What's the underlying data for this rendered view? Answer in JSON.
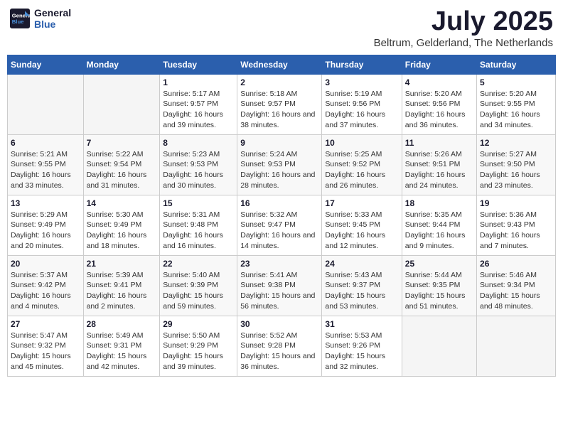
{
  "logo": {
    "text_general": "General",
    "text_blue": "Blue"
  },
  "title": "July 2025",
  "subtitle": "Beltrum, Gelderland, The Netherlands",
  "columns": [
    "Sunday",
    "Monday",
    "Tuesday",
    "Wednesday",
    "Thursday",
    "Friday",
    "Saturday"
  ],
  "weeks": [
    [
      {
        "day": "",
        "sunrise": "",
        "sunset": "",
        "daylight": ""
      },
      {
        "day": "",
        "sunrise": "",
        "sunset": "",
        "daylight": ""
      },
      {
        "day": "1",
        "sunrise": "Sunrise: 5:17 AM",
        "sunset": "Sunset: 9:57 PM",
        "daylight": "Daylight: 16 hours and 39 minutes."
      },
      {
        "day": "2",
        "sunrise": "Sunrise: 5:18 AM",
        "sunset": "Sunset: 9:57 PM",
        "daylight": "Daylight: 16 hours and 38 minutes."
      },
      {
        "day": "3",
        "sunrise": "Sunrise: 5:19 AM",
        "sunset": "Sunset: 9:56 PM",
        "daylight": "Daylight: 16 hours and 37 minutes."
      },
      {
        "day": "4",
        "sunrise": "Sunrise: 5:20 AM",
        "sunset": "Sunset: 9:56 PM",
        "daylight": "Daylight: 16 hours and 36 minutes."
      },
      {
        "day": "5",
        "sunrise": "Sunrise: 5:20 AM",
        "sunset": "Sunset: 9:55 PM",
        "daylight": "Daylight: 16 hours and 34 minutes."
      }
    ],
    [
      {
        "day": "6",
        "sunrise": "Sunrise: 5:21 AM",
        "sunset": "Sunset: 9:55 PM",
        "daylight": "Daylight: 16 hours and 33 minutes."
      },
      {
        "day": "7",
        "sunrise": "Sunrise: 5:22 AM",
        "sunset": "Sunset: 9:54 PM",
        "daylight": "Daylight: 16 hours and 31 minutes."
      },
      {
        "day": "8",
        "sunrise": "Sunrise: 5:23 AM",
        "sunset": "Sunset: 9:53 PM",
        "daylight": "Daylight: 16 hours and 30 minutes."
      },
      {
        "day": "9",
        "sunrise": "Sunrise: 5:24 AM",
        "sunset": "Sunset: 9:53 PM",
        "daylight": "Daylight: 16 hours and 28 minutes."
      },
      {
        "day": "10",
        "sunrise": "Sunrise: 5:25 AM",
        "sunset": "Sunset: 9:52 PM",
        "daylight": "Daylight: 16 hours and 26 minutes."
      },
      {
        "day": "11",
        "sunrise": "Sunrise: 5:26 AM",
        "sunset": "Sunset: 9:51 PM",
        "daylight": "Daylight: 16 hours and 24 minutes."
      },
      {
        "day": "12",
        "sunrise": "Sunrise: 5:27 AM",
        "sunset": "Sunset: 9:50 PM",
        "daylight": "Daylight: 16 hours and 23 minutes."
      }
    ],
    [
      {
        "day": "13",
        "sunrise": "Sunrise: 5:29 AM",
        "sunset": "Sunset: 9:49 PM",
        "daylight": "Daylight: 16 hours and 20 minutes."
      },
      {
        "day": "14",
        "sunrise": "Sunrise: 5:30 AM",
        "sunset": "Sunset: 9:49 PM",
        "daylight": "Daylight: 16 hours and 18 minutes."
      },
      {
        "day": "15",
        "sunrise": "Sunrise: 5:31 AM",
        "sunset": "Sunset: 9:48 PM",
        "daylight": "Daylight: 16 hours and 16 minutes."
      },
      {
        "day": "16",
        "sunrise": "Sunrise: 5:32 AM",
        "sunset": "Sunset: 9:47 PM",
        "daylight": "Daylight: 16 hours and 14 minutes."
      },
      {
        "day": "17",
        "sunrise": "Sunrise: 5:33 AM",
        "sunset": "Sunset: 9:45 PM",
        "daylight": "Daylight: 16 hours and 12 minutes."
      },
      {
        "day": "18",
        "sunrise": "Sunrise: 5:35 AM",
        "sunset": "Sunset: 9:44 PM",
        "daylight": "Daylight: 16 hours and 9 minutes."
      },
      {
        "day": "19",
        "sunrise": "Sunrise: 5:36 AM",
        "sunset": "Sunset: 9:43 PM",
        "daylight": "Daylight: 16 hours and 7 minutes."
      }
    ],
    [
      {
        "day": "20",
        "sunrise": "Sunrise: 5:37 AM",
        "sunset": "Sunset: 9:42 PM",
        "daylight": "Daylight: 16 hours and 4 minutes."
      },
      {
        "day": "21",
        "sunrise": "Sunrise: 5:39 AM",
        "sunset": "Sunset: 9:41 PM",
        "daylight": "Daylight: 16 hours and 2 minutes."
      },
      {
        "day": "22",
        "sunrise": "Sunrise: 5:40 AM",
        "sunset": "Sunset: 9:39 PM",
        "daylight": "Daylight: 15 hours and 59 minutes."
      },
      {
        "day": "23",
        "sunrise": "Sunrise: 5:41 AM",
        "sunset": "Sunset: 9:38 PM",
        "daylight": "Daylight: 15 hours and 56 minutes."
      },
      {
        "day": "24",
        "sunrise": "Sunrise: 5:43 AM",
        "sunset": "Sunset: 9:37 PM",
        "daylight": "Daylight: 15 hours and 53 minutes."
      },
      {
        "day": "25",
        "sunrise": "Sunrise: 5:44 AM",
        "sunset": "Sunset: 9:35 PM",
        "daylight": "Daylight: 15 hours and 51 minutes."
      },
      {
        "day": "26",
        "sunrise": "Sunrise: 5:46 AM",
        "sunset": "Sunset: 9:34 PM",
        "daylight": "Daylight: 15 hours and 48 minutes."
      }
    ],
    [
      {
        "day": "27",
        "sunrise": "Sunrise: 5:47 AM",
        "sunset": "Sunset: 9:32 PM",
        "daylight": "Daylight: 15 hours and 45 minutes."
      },
      {
        "day": "28",
        "sunrise": "Sunrise: 5:49 AM",
        "sunset": "Sunset: 9:31 PM",
        "daylight": "Daylight: 15 hours and 42 minutes."
      },
      {
        "day": "29",
        "sunrise": "Sunrise: 5:50 AM",
        "sunset": "Sunset: 9:29 PM",
        "daylight": "Daylight: 15 hours and 39 minutes."
      },
      {
        "day": "30",
        "sunrise": "Sunrise: 5:52 AM",
        "sunset": "Sunset: 9:28 PM",
        "daylight": "Daylight: 15 hours and 36 minutes."
      },
      {
        "day": "31",
        "sunrise": "Sunrise: 5:53 AM",
        "sunset": "Sunset: 9:26 PM",
        "daylight": "Daylight: 15 hours and 32 minutes."
      },
      {
        "day": "",
        "sunrise": "",
        "sunset": "",
        "daylight": ""
      },
      {
        "day": "",
        "sunrise": "",
        "sunset": "",
        "daylight": ""
      }
    ]
  ]
}
